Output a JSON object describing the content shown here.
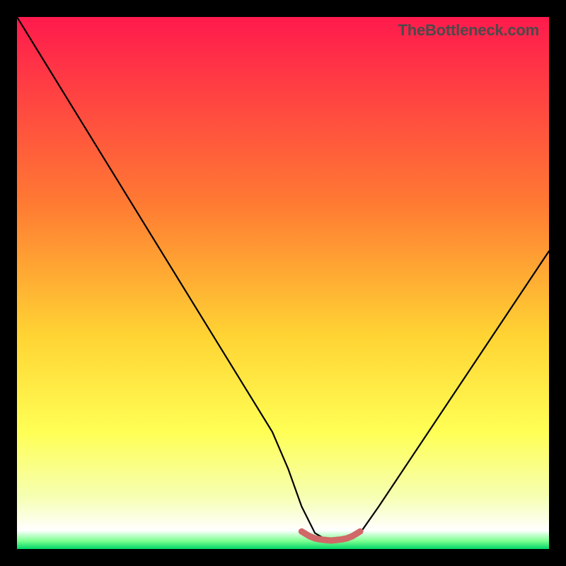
{
  "watermark": "TheBottleneck.com",
  "chart_data": {
    "type": "line",
    "title": "",
    "xlabel": "",
    "ylabel": "",
    "xlim": [
      0,
      100
    ],
    "ylim": [
      0,
      100
    ],
    "background_gradient": {
      "stops": [
        {
          "offset": 0.0,
          "color": "#ff1a4d"
        },
        {
          "offset": 0.35,
          "color": "#ff7a33"
        },
        {
          "offset": 0.6,
          "color": "#ffd433"
        },
        {
          "offset": 0.78,
          "color": "#ffff55"
        },
        {
          "offset": 0.9,
          "color": "#f6ffb0"
        },
        {
          "offset": 0.965,
          "color": "#ffffff"
        },
        {
          "offset": 0.985,
          "color": "#79ff8e"
        },
        {
          "offset": 1.0,
          "color": "#00d668"
        }
      ]
    },
    "series": [
      {
        "name": "curve",
        "stroke": "#000000",
        "x": [
          0.0,
          4.0,
          8.0,
          12.0,
          16.0,
          20.0,
          24.0,
          28.0,
          32.0,
          36.0,
          40.0,
          44.0,
          48.0,
          51.0,
          53.5,
          56.0,
          58.0,
          60.0,
          62.0,
          64.5,
          68.0,
          72.0,
          76.0,
          80.0,
          84.0,
          88.0,
          92.0,
          96.0,
          100.0
        ],
        "values": [
          100.0,
          93.5,
          87.0,
          80.5,
          74.0,
          67.5,
          61.0,
          54.5,
          48.0,
          41.5,
          35.0,
          28.5,
          22.0,
          15.0,
          8.0,
          3.0,
          1.8,
          1.5,
          1.8,
          3.0,
          8.0,
          14.0,
          20.0,
          26.0,
          32.0,
          38.0,
          44.0,
          50.0,
          56.0
        ]
      },
      {
        "name": "flat-marker",
        "stroke": "#d06868",
        "stroke_width": 9,
        "x": [
          53.5,
          55.0,
          56.0,
          57.0,
          58.0,
          59.0,
          60.0,
          61.0,
          62.0,
          63.0,
          64.5
        ],
        "values": [
          3.3,
          2.4,
          2.0,
          1.8,
          1.7,
          1.6,
          1.7,
          1.8,
          2.0,
          2.4,
          3.3
        ]
      }
    ]
  }
}
